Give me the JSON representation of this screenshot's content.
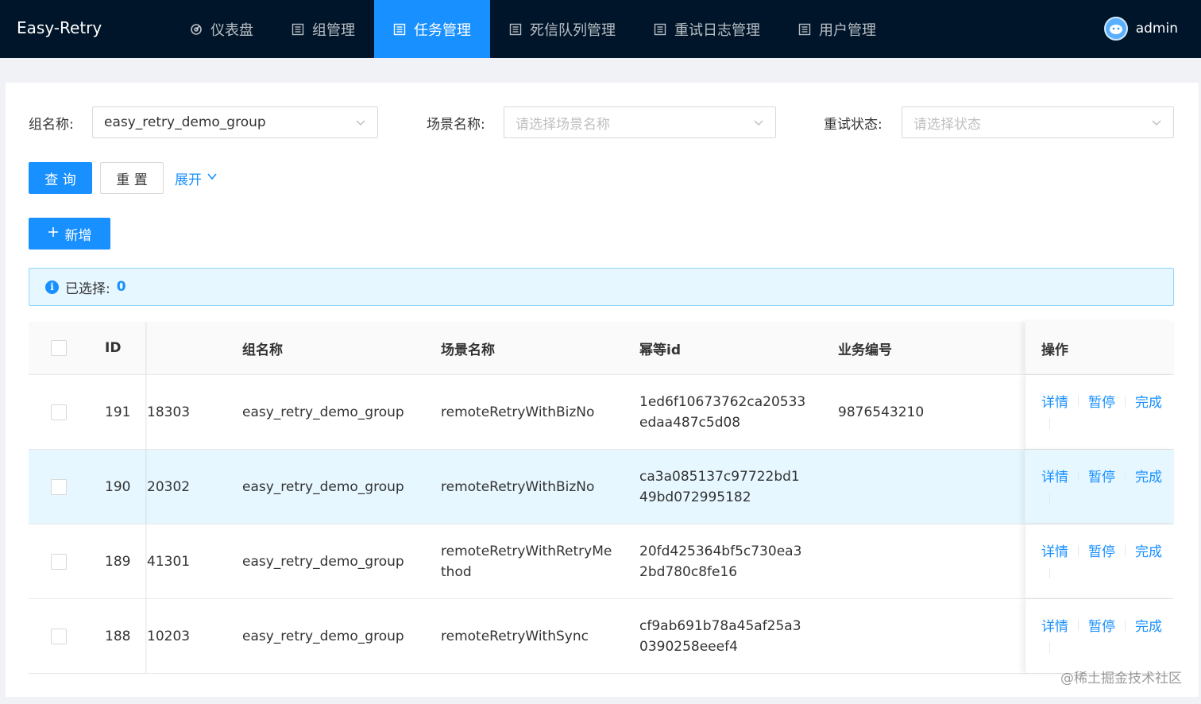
{
  "app": {
    "title": "Easy-Retry"
  },
  "nav": {
    "items": [
      {
        "label": "仪表盘",
        "icon": "dashboard-icon",
        "active": false
      },
      {
        "label": "组管理",
        "icon": "list-icon",
        "active": false
      },
      {
        "label": "任务管理",
        "icon": "list-icon",
        "active": true
      },
      {
        "label": "死信队列管理",
        "icon": "list-icon",
        "active": false
      },
      {
        "label": "重试日志管理",
        "icon": "list-icon",
        "active": false
      },
      {
        "label": "用户管理",
        "icon": "list-icon",
        "active": false
      }
    ]
  },
  "user": {
    "name": "admin"
  },
  "filters": {
    "group_label": "组名称:",
    "group_value": "easy_retry_demo_group",
    "scene_label": "场景名称:",
    "scene_placeholder": "请选择场景名称",
    "status_label": "重试状态:",
    "status_placeholder": "请选择状态"
  },
  "actions": {
    "query": "查 询",
    "reset": "重 置",
    "expand": "展开",
    "add": "新增"
  },
  "alert": {
    "label": "已选择:",
    "count": "0"
  },
  "table": {
    "columns": [
      "ID",
      "组名称",
      "场景名称",
      "幂等id",
      "业务编号",
      "操作"
    ],
    "rows": [
      {
        "id": "191",
        "code": "18303",
        "group": "easy_retry_demo_group",
        "scene": [
          "remoteRetryWithBizNo"
        ],
        "idem": [
          "1ed6f10673762ca20533",
          "edaa487c5d08"
        ],
        "biz": "9876543210",
        "highlight": false
      },
      {
        "id": "190",
        "code": "20302",
        "group": "easy_retry_demo_group",
        "scene": [
          "remoteRetryWithBizNo"
        ],
        "idem": [
          "ca3a085137c97722bd1",
          "49bd072995182"
        ],
        "biz": "",
        "highlight": true
      },
      {
        "id": "189",
        "code": "41301",
        "group": "easy_retry_demo_group",
        "scene": [
          "remoteRetryWithRetryMe",
          "thod"
        ],
        "idem": [
          "20fd425364bf5c730ea3",
          "2bd780c8fe16"
        ],
        "biz": "",
        "highlight": false
      },
      {
        "id": "188",
        "code": "10203",
        "group": "easy_retry_demo_group",
        "scene": [
          "remoteRetryWithSync"
        ],
        "idem": [
          "cf9ab691b78a45af25a3",
          "0390258eeef4"
        ],
        "biz": "",
        "highlight": false
      }
    ],
    "row_actions": [
      "详情",
      "暂停",
      "完成"
    ]
  },
  "watermark": "@稀土掘金技术社区",
  "colors": {
    "primary": "#1890ff",
    "header_bg": "#001529",
    "alert_bg": "#e6f7ff"
  }
}
